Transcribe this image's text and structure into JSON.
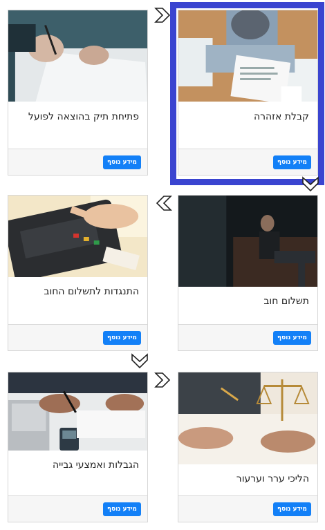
{
  "steps": [
    {
      "title": "קבלת אזהרה",
      "button": "מידע נוסף",
      "icon": "document-review-photo"
    },
    {
      "title": "פתיחת תיק בהוצאה לפועל",
      "button": "מידע נוסף",
      "icon": "signing-document-photo"
    },
    {
      "title": "תשלום חוב",
      "button": "מידע נוסף",
      "icon": "man-on-sofa-photo"
    },
    {
      "title": "התנגדות לתשלום החוב",
      "button": "מידע נוסף",
      "icon": "card-payment-terminal-photo"
    },
    {
      "title": "הליכי ערר וערעור",
      "button": "מידע נוסף",
      "icon": "scales-of-justice-photo"
    },
    {
      "title": "הגבלות ואמצעי גבייה",
      "button": "מידע נוסף",
      "icon": "calculator-laptop-photo"
    }
  ],
  "colors": {
    "highlight": "#3a44d0",
    "button": "#1380f7"
  }
}
